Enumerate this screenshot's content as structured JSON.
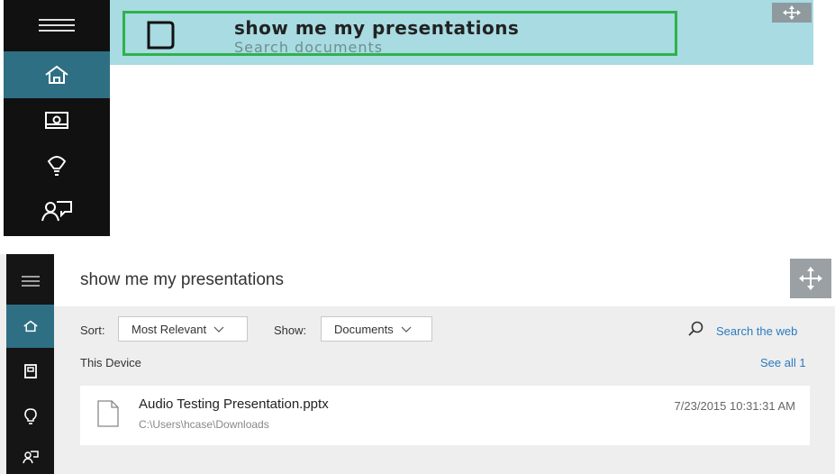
{
  "top": {
    "query": "show me my presentations",
    "subtitle": "Search documents",
    "sidebar": [
      {
        "icon": "hamburger-menu-icon"
      },
      {
        "icon": "home-icon",
        "active": true
      },
      {
        "icon": "notebook-icon"
      },
      {
        "icon": "lightbulb-icon"
      },
      {
        "icon": "feedback-icon"
      }
    ]
  },
  "bottom": {
    "query": "show me my presentations",
    "sort": {
      "label": "Sort:",
      "value": "Most Relevant"
    },
    "show": {
      "label": "Show:",
      "value": "Documents"
    },
    "search_web": "Search the web",
    "section": "This Device",
    "see_all": "See all 1",
    "results": [
      {
        "name": "Audio Testing Presentation.pptx",
        "path": "C:\\Users\\hcase\\Downloads",
        "date": "7/23/2015 10:31:31 AM"
      }
    ]
  },
  "colors": {
    "sidebar_bg": "#111111",
    "active_tab": "#2f6f83",
    "header_bg": "#a8dbe2",
    "highlight_border": "#2fb24a",
    "link": "#2a7bbf"
  }
}
